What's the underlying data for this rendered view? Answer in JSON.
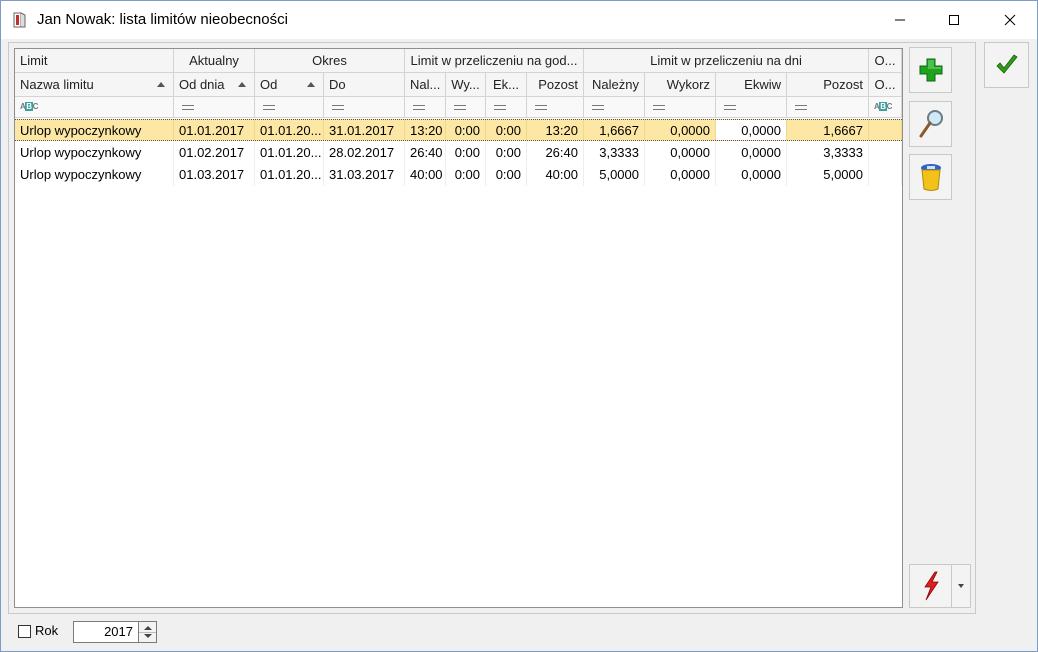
{
  "window": {
    "title": "Jan Nowak: lista limitów nieobecności",
    "minimize_icon": "minimize-icon",
    "maximize_icon": "maximize-icon",
    "close_icon": "close-icon"
  },
  "grid": {
    "group_headers": [
      "Limit",
      "Aktualny",
      "Okres",
      "Limit w przeliczeniu na god...",
      "Limit w przeliczeniu na dni",
      "O..."
    ],
    "columns": [
      "Nazwa limitu",
      "Od dnia",
      "Od",
      "Do",
      "Nal...",
      "Wy...",
      "Ek...",
      "Pozost",
      "Należny",
      "Wykorz",
      "Ekwiw",
      "Pozost",
      "O..."
    ],
    "rows": [
      [
        "Urlop wypoczynkowy",
        "01.01.2017",
        "01.01.20...",
        "31.01.2017",
        "13:20",
        "0:00",
        "0:00",
        "13:20",
        "1,6667",
        "0,0000",
        "0,0000",
        "1,6667",
        ""
      ],
      [
        "Urlop wypoczynkowy",
        "01.02.2017",
        "01.01.20...",
        "28.02.2017",
        "26:40",
        "0:00",
        "0:00",
        "26:40",
        "3,3333",
        "0,0000",
        "0,0000",
        "3,3333",
        ""
      ],
      [
        "Urlop wypoczynkowy",
        "01.03.2017",
        "01.01.20...",
        "31.03.2017",
        "40:00",
        "0:00",
        "0:00",
        "40:00",
        "5,0000",
        "0,0000",
        "0,0000",
        "5,0000",
        ""
      ]
    ],
    "selected_row": 0
  },
  "toolbar": {
    "add_icon": "plus-icon",
    "edit_icon": "magnifier-icon",
    "delete_icon": "trash-icon",
    "action_icon": "lightning-icon",
    "ok_icon": "checkmark-icon"
  },
  "footer": {
    "rok_label": "Rok",
    "rok_checked": false,
    "year_value": "2017"
  },
  "colors": {
    "selected_row": "#fde7a4",
    "plus_green": "#1fa31f",
    "check_green": "#2e9d1a",
    "lightning_red": "#e02020"
  }
}
